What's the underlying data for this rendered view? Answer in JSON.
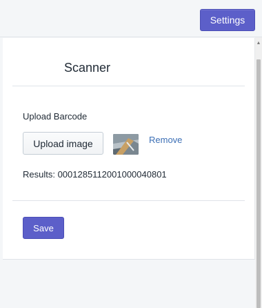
{
  "toolbar": {
    "settings_label": "Settings"
  },
  "scanner": {
    "title": "Scanner",
    "upload_label": "Upload Barcode",
    "upload_button_label": "Upload image",
    "remove_label": "Remove",
    "results_text": "Results: 0001285112001000040801",
    "save_label": "Save"
  },
  "colors": {
    "primary": "#5c5fc9",
    "link": "#3c6fb5",
    "background": "#f4f6f8"
  },
  "icons": {
    "thumbnail": "barcode-image-thumbnail",
    "scroll_up": "scroll-up-arrow-icon"
  }
}
